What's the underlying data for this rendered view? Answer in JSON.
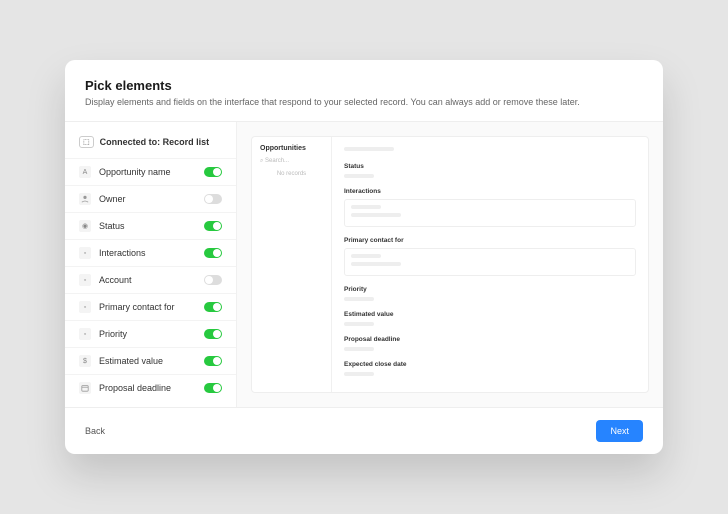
{
  "header": {
    "title": "Pick elements",
    "subtitle": "Display elements and fields on the interface that respond to your selected record. You can always add or remove these later."
  },
  "sidebar": {
    "connected_label": "Connected to: Record list",
    "fields": [
      {
        "icon": "A",
        "label": "Opportunity name",
        "on": true
      },
      {
        "icon": "user",
        "label": "Owner",
        "on": false
      },
      {
        "icon": "status",
        "label": "Status",
        "on": true
      },
      {
        "icon": "interactions",
        "label": "Interactions",
        "on": true
      },
      {
        "icon": "account",
        "label": "Account",
        "on": false
      },
      {
        "icon": "contact",
        "label": "Primary contact for",
        "on": true
      },
      {
        "icon": "priority",
        "label": "Priority",
        "on": true
      },
      {
        "icon": "$",
        "label": "Estimated value",
        "on": true
      },
      {
        "icon": "date",
        "label": "Proposal deadline",
        "on": true
      }
    ]
  },
  "preview": {
    "list_title": "Opportunities",
    "search_placeholder": "Search...",
    "no_records": "No records",
    "sections": [
      {
        "label": "Status",
        "type": "text"
      },
      {
        "label": "Interactions",
        "type": "box"
      },
      {
        "label": "Primary contact for",
        "type": "box"
      },
      {
        "label": "Priority",
        "type": "text"
      },
      {
        "label": "Estimated value",
        "type": "text"
      },
      {
        "label": "Proposal deadline",
        "type": "text"
      },
      {
        "label": "Expected close date",
        "type": "text"
      }
    ]
  },
  "footer": {
    "back": "Back",
    "next": "Next"
  }
}
